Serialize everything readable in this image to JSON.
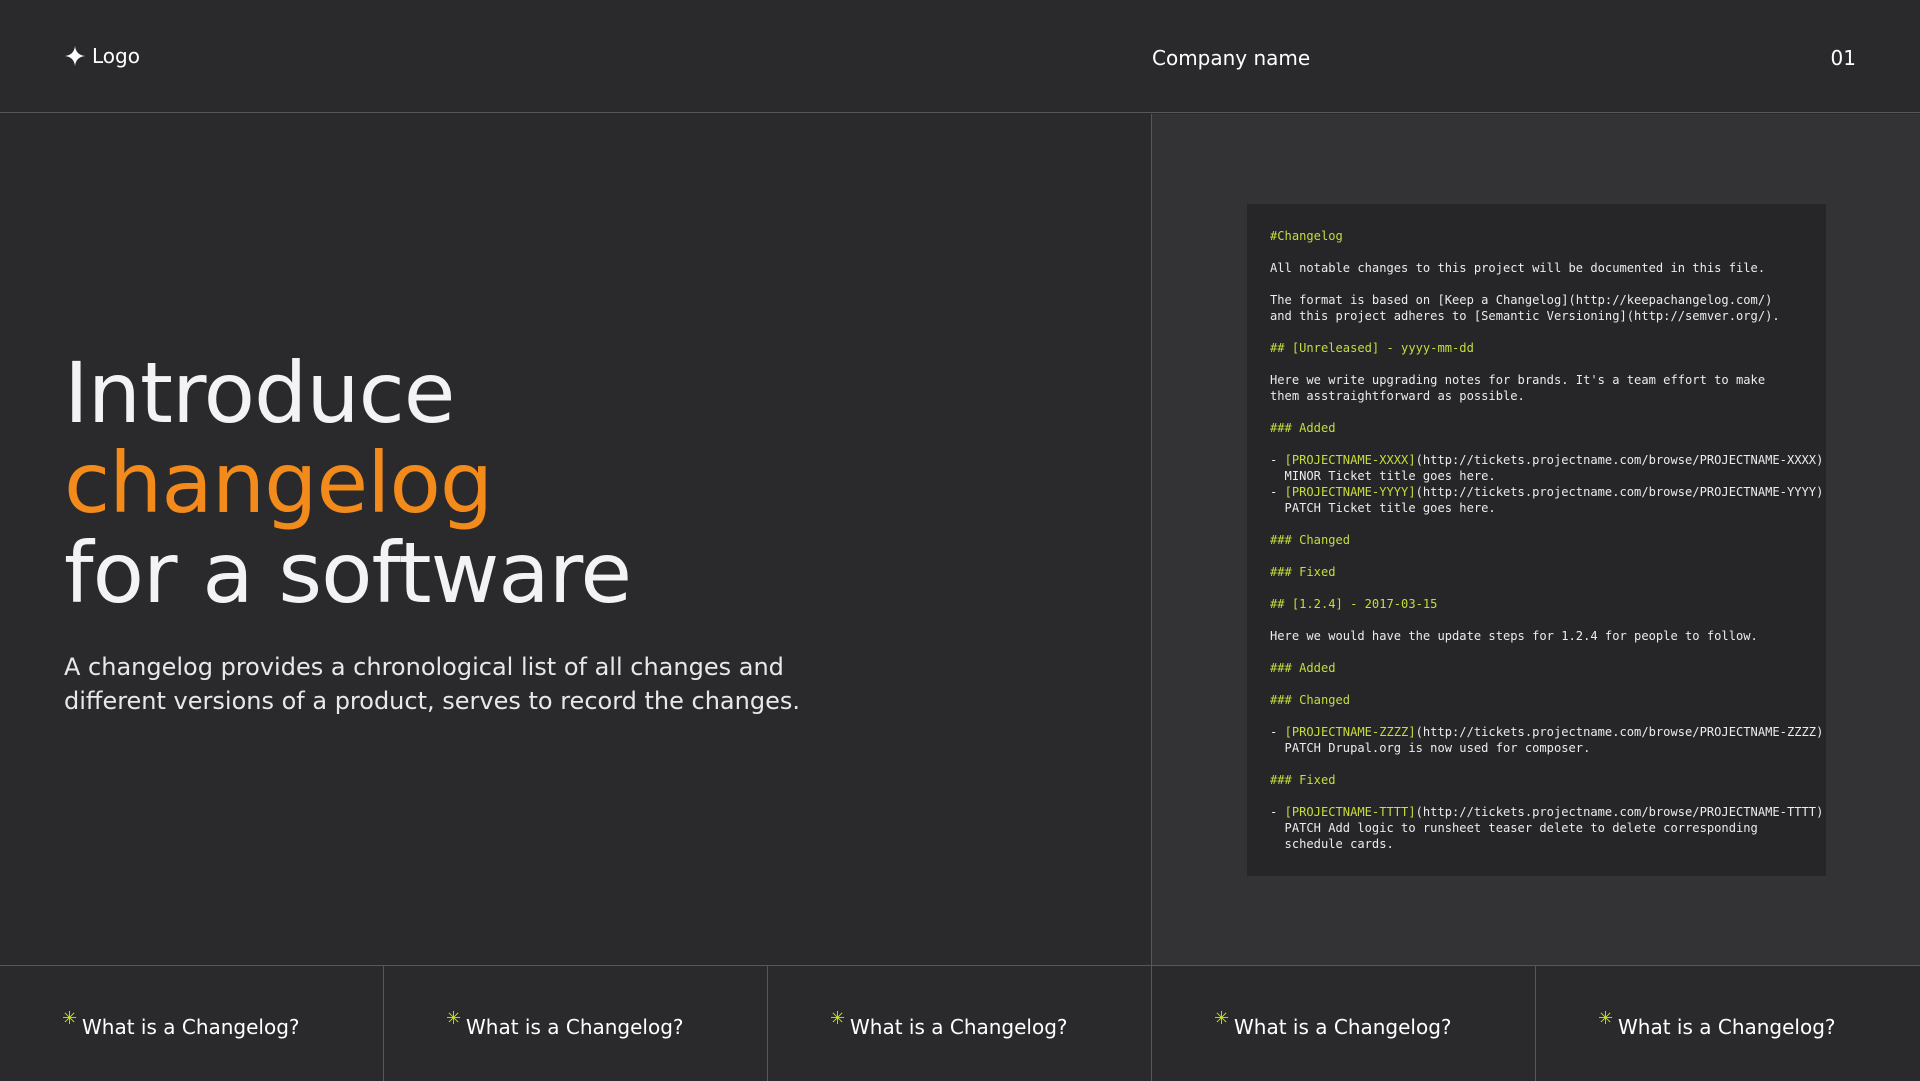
{
  "header": {
    "logo_label": "Logo",
    "logo_icon": "sparkle-icon",
    "company_name": "Company name",
    "page_number": "01"
  },
  "hero": {
    "title_line1": "Introduce",
    "title_line2": "changelog",
    "title_line3": "for a software",
    "description": "A changelog provides a chronological list of all changes and different versions of a product, serves to record the changes."
  },
  "code": {
    "lines": [
      {
        "t": "#Changelog",
        "kind": "hl"
      },
      {
        "t": "",
        "kind": "gap"
      },
      {
        "t": "All notable changes to this project will be documented in this file.",
        "kind": "plain"
      },
      {
        "t": "",
        "kind": "gap"
      },
      {
        "t": "The format is based on [Keep a Changelog](http://keepachangelog.com/)",
        "kind": "plain"
      },
      {
        "t": "and this project adheres to [Semantic Versioning](http://semver.org/).",
        "kind": "plain"
      },
      {
        "t": "",
        "kind": "gap"
      },
      {
        "t": "## [Unreleased] - yyyy-mm-dd",
        "kind": "hl"
      },
      {
        "t": "",
        "kind": "gap"
      },
      {
        "t": "Here we write upgrading notes for brands. It's a team effort to make",
        "kind": "plain"
      },
      {
        "t": "them asstraightforward as possible.",
        "kind": "plain"
      },
      {
        "t": "",
        "kind": "gap"
      },
      {
        "t": "### Added",
        "kind": "hl"
      },
      {
        "t": "",
        "kind": "gap"
      },
      {
        "pre": "- ",
        "hl": "[PROJECTNAME-XXXX]",
        "post": "(http://tickets.projectname.com/browse/PROJECTNAME-XXXX)",
        "kind": "mixed"
      },
      {
        "t": "  MINOR Ticket title goes here.",
        "kind": "plain"
      },
      {
        "pre": "- ",
        "hl": "[PROJECTNAME-YYYY]",
        "post": "(http://tickets.projectname.com/browse/PROJECTNAME-YYYY)",
        "kind": "mixed"
      },
      {
        "t": "  PATCH Ticket title goes here.",
        "kind": "plain"
      },
      {
        "t": "",
        "kind": "gap"
      },
      {
        "t": "### Changed",
        "kind": "hl"
      },
      {
        "t": "",
        "kind": "gap"
      },
      {
        "t": "### Fixed",
        "kind": "hl"
      },
      {
        "t": "",
        "kind": "gap"
      },
      {
        "t": "## [1.2.4] - 2017-03-15",
        "kind": "hl"
      },
      {
        "t": "",
        "kind": "gap"
      },
      {
        "t": "Here we would have the update steps for 1.2.4 for people to follow.",
        "kind": "plain"
      },
      {
        "t": "",
        "kind": "gap"
      },
      {
        "t": "### Added",
        "kind": "hl"
      },
      {
        "t": "",
        "kind": "gap"
      },
      {
        "t": "### Changed",
        "kind": "hl"
      },
      {
        "t": "",
        "kind": "gap"
      },
      {
        "pre": "- ",
        "hl": "[PROJECTNAME-ZZZZ]",
        "post": "(http://tickets.projectname.com/browse/PROJECTNAME-ZZZZ)",
        "kind": "mixed"
      },
      {
        "t": "  PATCH Drupal.org is now used for composer.",
        "kind": "plain"
      },
      {
        "t": "",
        "kind": "gap"
      },
      {
        "t": "### Fixed",
        "kind": "hl"
      },
      {
        "t": "",
        "kind": "gap"
      },
      {
        "pre": "- ",
        "hl": "[PROJECTNAME-TTTT]",
        "post": "(http://tickets.projectname.com/browse/PROJECTNAME-TTTT)",
        "kind": "mixed"
      },
      {
        "t": "  PATCH Add logic to runsheet teaser delete to delete corresponding",
        "kind": "plain"
      },
      {
        "t": "  schedule cards.",
        "kind": "plain"
      }
    ]
  },
  "footer": {
    "items": [
      {
        "label": "What is a Changelog?",
        "icon": "asterisk-icon"
      },
      {
        "label": "What is a Changelog?",
        "icon": "asterisk-icon"
      },
      {
        "label": "What is a Changelog?",
        "icon": "asterisk-icon"
      },
      {
        "label": "What is a Changelog?",
        "icon": "asterisk-icon"
      },
      {
        "label": "What is a Changelog?",
        "icon": "asterisk-icon"
      }
    ]
  },
  "colors": {
    "background": "#2a292b",
    "panel": "#333235",
    "code_bg": "#262527",
    "accent_orange": "#f28a1c",
    "accent_lime": "#c7dc3e"
  }
}
